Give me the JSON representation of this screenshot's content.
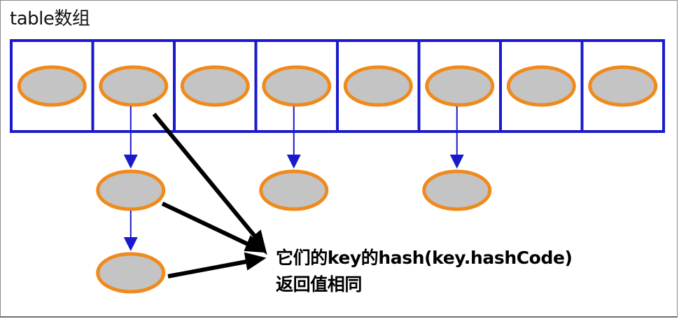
{
  "title": "table数组",
  "note": {
    "line1": "它们的key的hash(key.hashCode)",
    "line2": "返回值相同"
  },
  "colors": {
    "table_border": "#1a1acc",
    "node_fill": "#c4c4c4",
    "node_stroke": "#f08a1c",
    "link_arrow": "#1a1acc",
    "callout_arrow": "#000000"
  },
  "table": {
    "slot_count": 8
  },
  "chains": [
    {
      "slot": 1,
      "length": 2
    },
    {
      "slot": 3,
      "length": 1
    },
    {
      "slot": 5,
      "length": 1
    }
  ],
  "icons": [
    "node-ellipse",
    "down-arrow",
    "callout-arrow"
  ]
}
